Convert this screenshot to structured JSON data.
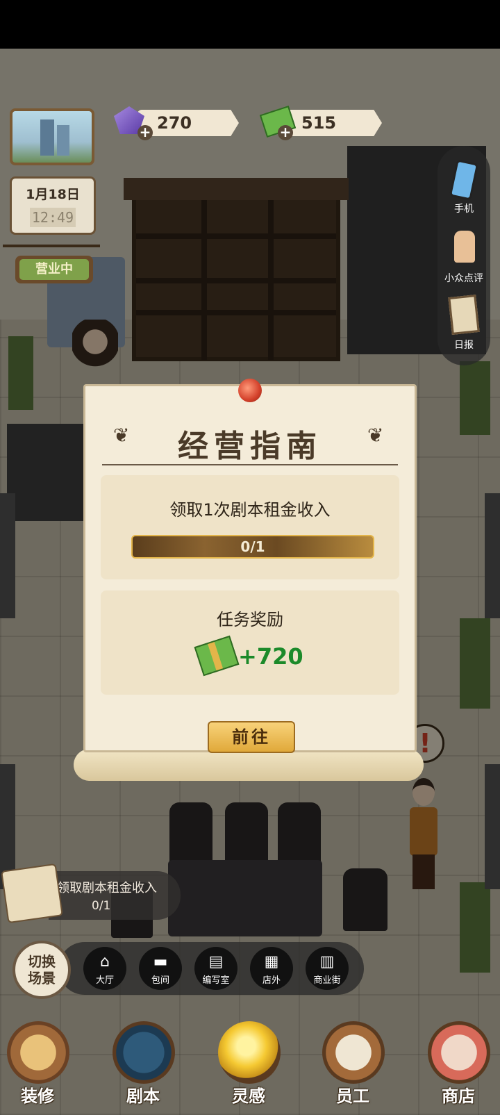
{
  "status_bar": {},
  "resources": {
    "gems": "270",
    "cash": "515"
  },
  "calendar": {
    "date": "1月18日",
    "time": "12:49"
  },
  "business_sign": "营业中",
  "side_menu": [
    {
      "label": "手机",
      "icon": "phone-icon"
    },
    {
      "label": "小众点评",
      "icon": "thumbs-up-icon"
    },
    {
      "label": "日报",
      "icon": "clipboard-icon"
    }
  ],
  "modal": {
    "title": "经营指南",
    "task_text": "领取1次剧本租金收入",
    "progress_text": "0/1",
    "progress_fraction": 0,
    "reward_title": "任务奖励",
    "reward_amount": "+720",
    "go_button": "前往"
  },
  "task_bubble": {
    "text": "领取剧本租金收入",
    "count": "0/1"
  },
  "scene_switch": "切换场景",
  "scene_nav": [
    {
      "label": "大厅",
      "icon": "house-icon"
    },
    {
      "label": "包间",
      "icon": "sofa-icon"
    },
    {
      "label": "编写室",
      "icon": "desk-icon"
    },
    {
      "label": "店外",
      "icon": "storefront-icon"
    },
    {
      "label": "商业街",
      "icon": "shop-icon"
    }
  ],
  "tabs": [
    {
      "label": "装修",
      "icon": "house-renovate-icon"
    },
    {
      "label": "剧本",
      "icon": "book-icon"
    },
    {
      "label": "灵感",
      "icon": "lightbulb-icon"
    },
    {
      "label": "员工",
      "icon": "id-card-icon"
    },
    {
      "label": "商店",
      "icon": "shop-store-icon"
    }
  ],
  "colors": {
    "reward_green": "#1c8a2a",
    "modal_bg": "#f4ecd9",
    "button_gold": "#e0a93a"
  }
}
